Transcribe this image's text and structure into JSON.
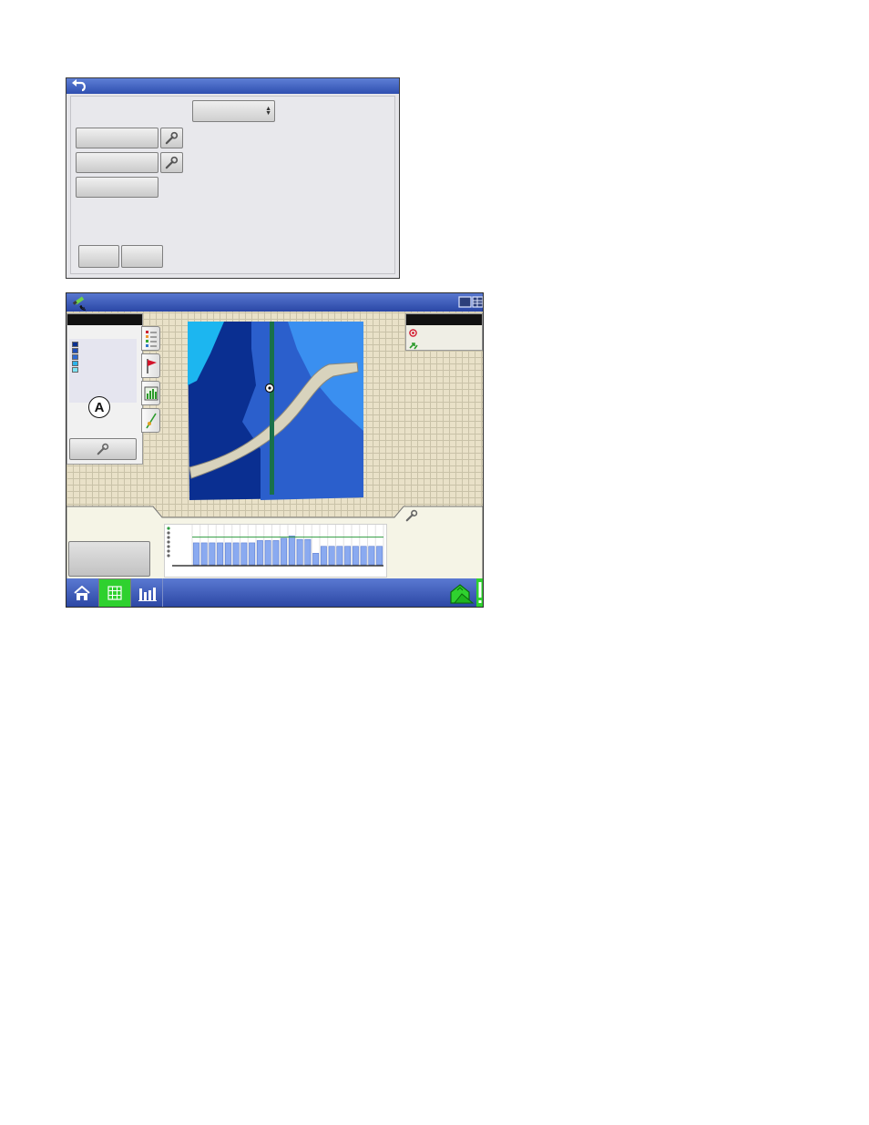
{
  "dialog": {
    "icons": {
      "back": "back-arrow-icon",
      "wrench": "wrench-icon"
    },
    "colors": {
      "titlebar": "#3556b8",
      "panel": "#e8e8ec"
    }
  },
  "run_screen": {
    "map": {
      "marker": "vehicle-position-icon",
      "colors": {
        "deep": "#0a2f91",
        "mid": "#2b5fcc",
        "light": "#3a8ff0",
        "cyan": "#1cb6f0",
        "path": "#d8d3bd",
        "guidance": "#19704a"
      }
    },
    "legend": {
      "swatches": [
        "#0a2f91",
        "#1f4eb8",
        "#2e6ad4",
        "#2db2ea",
        "#7be3f3"
      ],
      "badge": "A"
    },
    "side_tabs": [
      "legend-tab-icon",
      "flag-icon",
      "field-chart-icon",
      "guidance-line-icon"
    ],
    "status_icons": [
      "target-icon",
      "gps-arrows-icon"
    ],
    "chart_data": {
      "type": "bar",
      "values": [
        19,
        19,
        19,
        19,
        19,
        19,
        19,
        19,
        21,
        21,
        21,
        23,
        25,
        22,
        22,
        10,
        16,
        16,
        16,
        16,
        16,
        16,
        16,
        16
      ],
      "ylim": [
        0,
        30
      ],
      "target_line": 24,
      "grid": true,
      "bar_color": "#8aaaf0",
      "target_color": "#2e9b3f"
    },
    "bottom_bar": {
      "icons": [
        "home-icon",
        "map-grid-icon",
        "bar-chart-icon",
        "field-house-icon"
      ],
      "active": "map-grid-icon",
      "active_color": "#2fd12f"
    }
  }
}
